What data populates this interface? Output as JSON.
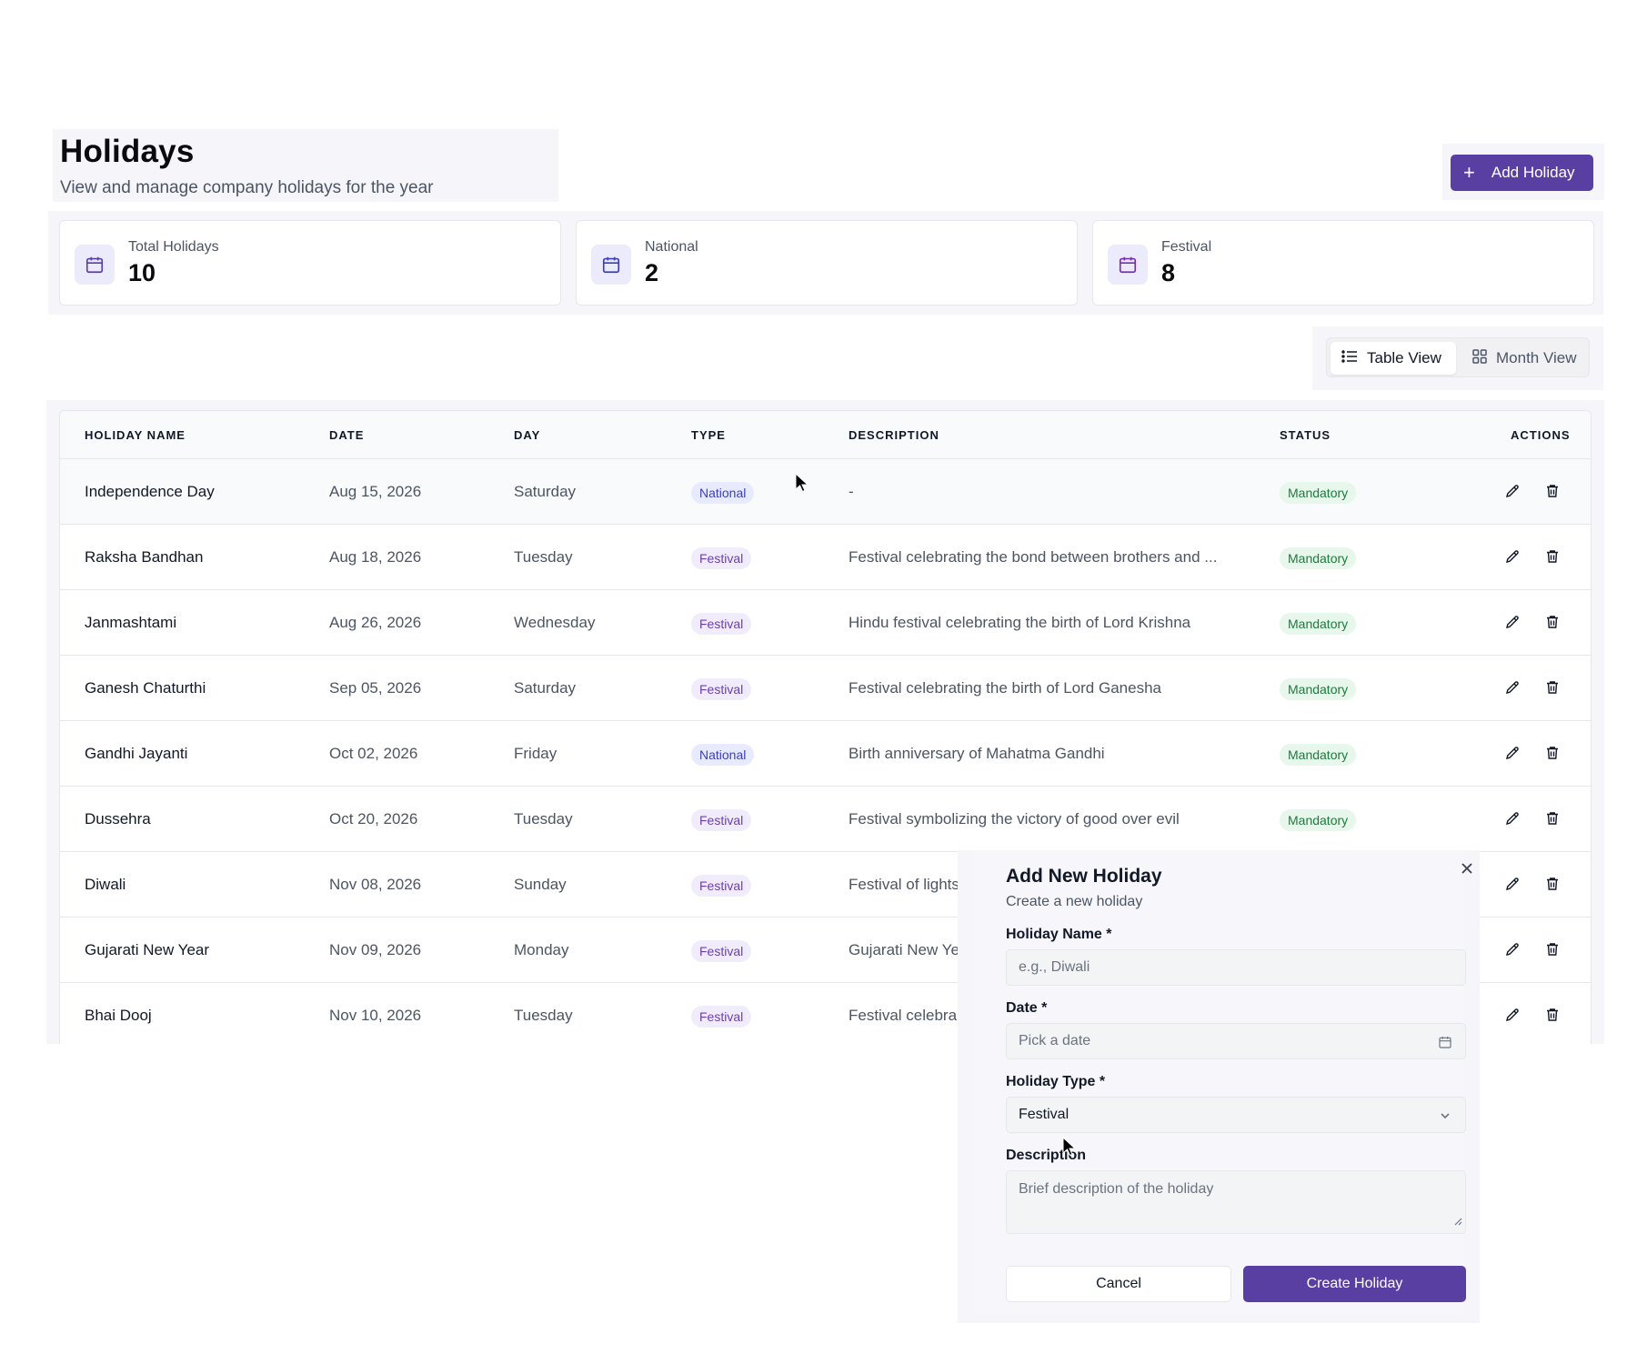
{
  "header": {
    "title": "Holidays",
    "subtitle": "View and manage company holidays for the year",
    "add_button_label": "Add Holiday"
  },
  "stats": [
    {
      "label": "Total Holidays",
      "value": "10"
    },
    {
      "label": "National",
      "value": "2"
    },
    {
      "label": "Festival",
      "value": "8"
    }
  ],
  "view_toggle": {
    "table_label": "Table View",
    "month_label": "Month View",
    "active": "Table View"
  },
  "table": {
    "columns": [
      "HOLIDAY NAME",
      "DATE",
      "DAY",
      "TYPE",
      "DESCRIPTION",
      "STATUS",
      "ACTIONS"
    ],
    "rows": [
      {
        "name": "Independence Day",
        "date": "Aug 15, 2026",
        "day": "Saturday",
        "type": "National",
        "description": "-",
        "status": "Mandatory"
      },
      {
        "name": "Raksha Bandhan",
        "date": "Aug 18, 2026",
        "day": "Tuesday",
        "type": "Festival",
        "description": "Festival celebrating the bond between brothers and ...",
        "status": "Mandatory"
      },
      {
        "name": "Janmashtami",
        "date": "Aug 26, 2026",
        "day": "Wednesday",
        "type": "Festival",
        "description": "Hindu festival celebrating the birth of Lord Krishna",
        "status": "Mandatory"
      },
      {
        "name": "Ganesh Chaturthi",
        "date": "Sep 05, 2026",
        "day": "Saturday",
        "type": "Festival",
        "description": "Festival celebrating the birth of Lord Ganesha",
        "status": "Mandatory"
      },
      {
        "name": "Gandhi Jayanti",
        "date": "Oct 02, 2026",
        "day": "Friday",
        "type": "National",
        "description": "Birth anniversary of Mahatma Gandhi",
        "status": "Mandatory"
      },
      {
        "name": "Dussehra",
        "date": "Oct 20, 2026",
        "day": "Tuesday",
        "type": "Festival",
        "description": "Festival symbolizing the victory of good over evil",
        "status": "Mandatory"
      },
      {
        "name": "Diwali",
        "date": "Nov 08, 2026",
        "day": "Sunday",
        "type": "Festival",
        "description": "Festival of lights",
        "status": ""
      },
      {
        "name": "Gujarati New Year",
        "date": "Nov 09, 2026",
        "day": "Monday",
        "type": "Festival",
        "description": "Gujarati New Ye",
        "status": ""
      },
      {
        "name": "Bhai Dooj",
        "date": "Nov 10, 2026",
        "day": "Tuesday",
        "type": "Festival",
        "description": "Festival celebra",
        "status": ""
      }
    ]
  },
  "modal": {
    "title": "Add New Holiday",
    "subtitle": "Create a new holiday",
    "name_label": "Holiday Name *",
    "name_placeholder": "e.g., Diwali",
    "date_label": "Date *",
    "date_placeholder": "Pick a date",
    "type_label": "Holiday Type *",
    "type_value": "Festival",
    "description_label": "Description",
    "description_placeholder": "Brief description of the holiday",
    "cancel_label": "Cancel",
    "create_label": "Create Holiday"
  },
  "icons": {
    "stat": "calendar-icon",
    "edit": "pencil-icon",
    "delete": "trash-icon",
    "close": "close-icon",
    "add": "plus-icon",
    "table_view": "list-icon",
    "month_view": "grid-icon"
  },
  "colors": {
    "accent": "#5a3fa3",
    "national_badge_bg": "#e8ebff",
    "festival_badge_bg": "#f1ecfb",
    "status_badge_bg": "#e7f7ec"
  }
}
